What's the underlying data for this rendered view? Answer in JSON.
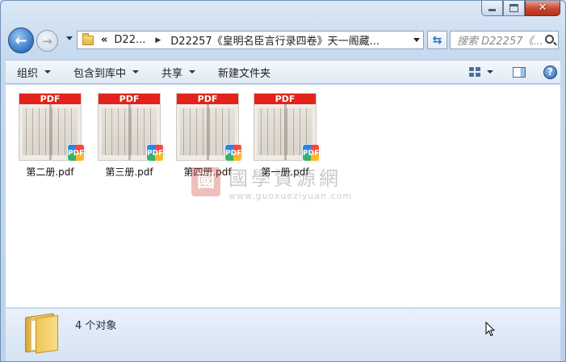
{
  "window": {
    "caption": {
      "minimize": "minimize",
      "maximize": "maximize",
      "close": "✕"
    }
  },
  "nav": {
    "back_glyph": "←",
    "forward_glyph": "→"
  },
  "address": {
    "chevrons": "«",
    "crumb_parent": "D22...",
    "crumb_current": "D22257《皇明名臣言行录四卷》天一阁藏..."
  },
  "search": {
    "placeholder": "搜索 D22257《..."
  },
  "commands": {
    "organize": "组织",
    "include_in_library": "包含到库中",
    "share": "共享",
    "new_folder": "新建文件夹",
    "help": "?"
  },
  "files": [
    {
      "name": "第二册.pdf",
      "band": "PDF",
      "badge": "PDF"
    },
    {
      "name": "第三册.pdf",
      "band": "PDF",
      "badge": "PDF"
    },
    {
      "name": "第四册.pdf",
      "band": "PDF",
      "badge": "PDF"
    },
    {
      "name": "第一册.pdf",
      "band": "PDF",
      "badge": "PDF"
    }
  ],
  "watermark": {
    "seal": "國",
    "chinese": "國學資源網",
    "url": "www.guoxueziyuan.com"
  },
  "details": {
    "count": "4 个对象"
  },
  "colors": {
    "pdf_red": "#e3231b",
    "chrome_blue": "#c6d9ee"
  }
}
